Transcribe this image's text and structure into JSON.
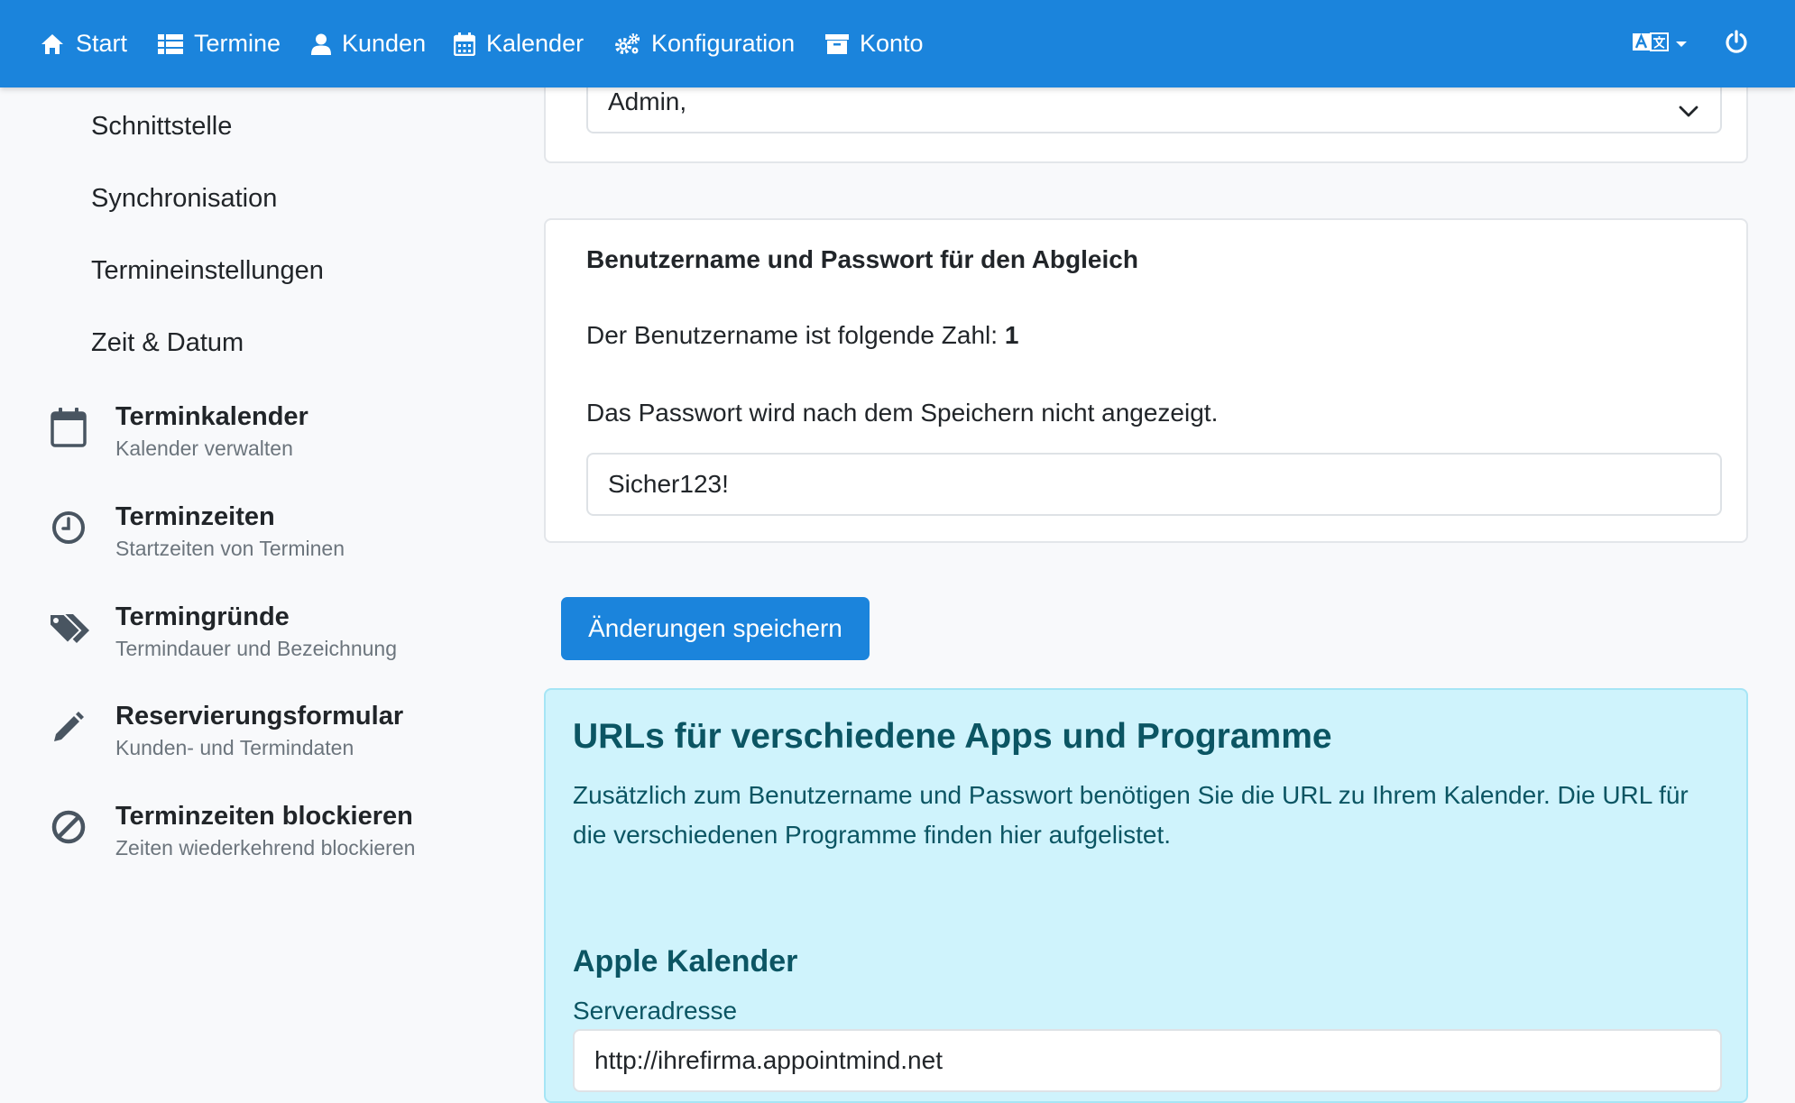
{
  "navbar": {
    "items": [
      {
        "label": "Start",
        "icon": "home-icon"
      },
      {
        "label": "Termine",
        "icon": "list-icon"
      },
      {
        "label": "Kunden",
        "icon": "user-icon"
      },
      {
        "label": "Kalender",
        "icon": "calendar-icon"
      },
      {
        "label": "Konfiguration",
        "icon": "gears-icon"
      },
      {
        "label": "Konto",
        "icon": "archive-box-icon"
      }
    ],
    "language_icon": "translate-icon",
    "power_icon": "power-icon"
  },
  "sidebar": {
    "sub_items": [
      "Schnittstelle",
      "Synchronisation",
      "Termineinstellungen",
      "Zeit & Datum"
    ],
    "entries": [
      {
        "title": "Terminkalender",
        "subtitle": "Kalender verwalten",
        "icon": "calendar-icon"
      },
      {
        "title": "Terminzeiten",
        "subtitle": "Startzeiten von Terminen",
        "icon": "clock-icon"
      },
      {
        "title": "Termingründe",
        "subtitle": "Termindauer und Bezeichnung",
        "icon": "tags-icon"
      },
      {
        "title": "Reservierungsformular",
        "subtitle": "Kunden- und Termindaten",
        "icon": "pencil-icon"
      },
      {
        "title": "Terminzeiten blockieren",
        "subtitle": "Zeiten wiederkehrend blockieren",
        "icon": "ban-icon"
      }
    ]
  },
  "main": {
    "select_value": "Admin,",
    "credentials": {
      "heading": "Benutzername und Passwort für den Abgleich",
      "username_text": "Der Benutzername ist folgende Zahl: ",
      "username_value": "1",
      "password_note": "Das Passwort wird nach dem Speichern nicht angezeigt.",
      "password_value": "Sicher123!"
    },
    "save_label": "Änderungen speichern",
    "urls": {
      "title": "URLs für verschiedene Apps und Programme",
      "text": "Zusätzlich zum Benutzername und Passwort benötigen Sie die URL zu Ihrem Kalender. Die URL für die verschiedenen Programme finden hier aufgelistet.",
      "apple_heading": "Apple Kalender",
      "server_label": "Serveradresse",
      "server_value": "http://ihrefirma.appointmind.net"
    }
  },
  "colors": {
    "navbar": "#1b84dc",
    "info_bg": "#cff3fc",
    "info_text": "#0b5563",
    "primary": "#1b84dc"
  }
}
